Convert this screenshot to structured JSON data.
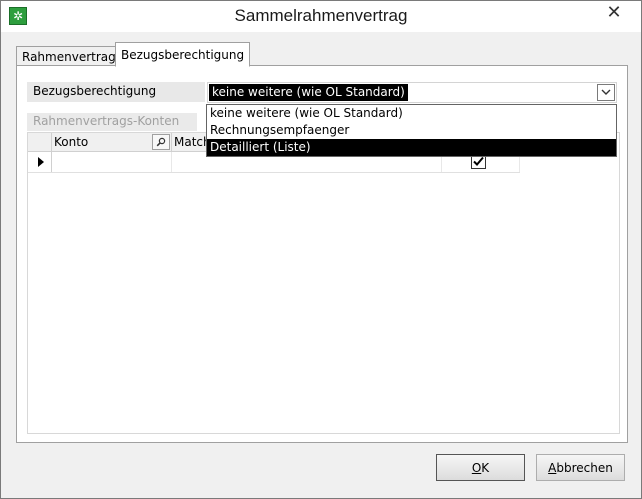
{
  "window": {
    "title": "Sammelrahmenvertrag",
    "close_symbol": "✕",
    "app_icon": "green-app-icon"
  },
  "tabs": [
    {
      "label": "Rahmenvertrag",
      "active": false
    },
    {
      "label": "Bezugsberechtigung",
      "active": true
    }
  ],
  "form": {
    "bezug_label": "Bezugsberechtigung",
    "bezug_value": "keine weitere (wie OL Standard)",
    "section_label": "Rahmenvertrags-Konten"
  },
  "grid": {
    "columns": [
      "Konto",
      "Match"
    ],
    "rows": [
      {
        "konto": "",
        "match": "",
        "checked": true
      }
    ]
  },
  "dropdown": {
    "options": [
      {
        "label": "keine weitere (wie OL Standard)",
        "selected": false
      },
      {
        "label": "Rechnungsempfaenger",
        "selected": false
      },
      {
        "label": "Detailliert (Liste)",
        "selected": true
      }
    ]
  },
  "buttons": {
    "ok": {
      "mnemonic": "O",
      "rest": "K"
    },
    "cancel": {
      "mnemonic": "A",
      "rest": "bbrechen"
    }
  },
  "colors": {
    "app_icon": "#2e9e3e",
    "selection": "#000000",
    "background": "#f0f0f0"
  }
}
